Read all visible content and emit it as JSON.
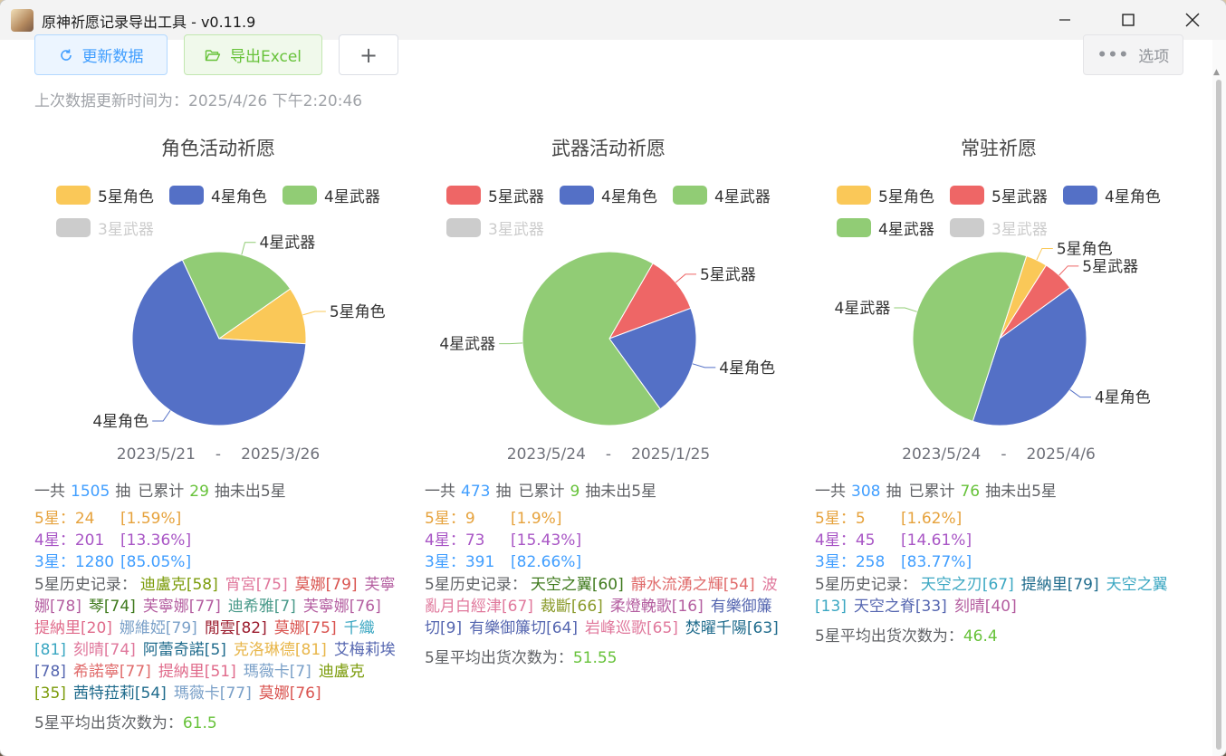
{
  "window": {
    "title": "原神祈愿记录导出工具 - v0.11.9"
  },
  "toolbar": {
    "refresh_label": "更新数据",
    "export_label": "导出Excel",
    "add_label": "+",
    "options_label": "选项"
  },
  "update_text": "上次数据更新时间为：2025/4/26 下午2:20:46",
  "colors": {
    "5star_char": "#fac858",
    "4star_char": "#5470c6",
    "4star_weapon": "#91cc75",
    "5star_weapon": "#ee6666",
    "3star_weapon": "#cccccc"
  },
  "panels": [
    {
      "title": "角色活动祈愿",
      "legend": [
        {
          "label": "5星角色",
          "color": "#fac858",
          "on": true
        },
        {
          "label": "4星角色",
          "color": "#5470c6",
          "on": true
        },
        {
          "label": "4星武器",
          "color": "#91cc75",
          "on": true
        },
        {
          "label": "3星武器",
          "color": "#cccccc",
          "on": false
        }
      ],
      "chart_data": {
        "type": "pie",
        "slices": [
          {
            "label": "5星角色",
            "value": 24,
            "color": "#fac858"
          },
          {
            "label": "4星角色",
            "value": 151,
            "color": "#5470c6"
          },
          {
            "label": "4星武器",
            "value": 50,
            "color": "#91cc75"
          }
        ]
      },
      "date_start": "2023/5/21",
      "date_sep": "-",
      "date_end": "2025/3/26",
      "total_prefix": "一共",
      "total": "1505",
      "total_unit": "抽",
      "acc_prefix": "已累计",
      "acc": "29",
      "acc_suffix": "抽未出5星",
      "stats": [
        {
          "label": "5星：24",
          "pct": "[1.59%]",
          "color": "#e6a23c"
        },
        {
          "label": "4星：201",
          "pct": "[13.36%]",
          "color": "#a855c5"
        },
        {
          "label": "3星：1280",
          "pct": "[85.05%]",
          "color": "#409eff"
        }
      ],
      "history_label": "5星历史记录：",
      "history": [
        {
          "text": "迪盧克[58]",
          "color": "#7b9b0a"
        },
        {
          "text": "宵宮[75]",
          "color": "#e0789c"
        },
        {
          "text": "莫娜[79]",
          "color": "#d9534f"
        },
        {
          "text": "芙寧娜[78]",
          "color": "#b45ea0"
        },
        {
          "text": "琴[74]",
          "color": "#3f7a1e"
        },
        {
          "text": "芙寧娜[77]",
          "color": "#b45ea0"
        },
        {
          "text": "迪希雅[7]",
          "color": "#4a9a8a"
        },
        {
          "text": "芙寧娜[76]",
          "color": "#b45ea0"
        },
        {
          "text": "提納里[20]",
          "color": "#e06b8b"
        },
        {
          "text": "娜維婭[79]",
          "color": "#7aa0c8"
        },
        {
          "text": "閒雲[82]",
          "color": "#9b1c2e"
        },
        {
          "text": "莫娜[75]",
          "color": "#d9534f"
        },
        {
          "text": "千織[81]",
          "color": "#3ba7c2"
        },
        {
          "text": "刻晴[74]",
          "color": "#e0789c"
        },
        {
          "text": "阿蕾奇諾[5]",
          "color": "#1f6b8c"
        },
        {
          "text": "克洛琳德[81]",
          "color": "#e8b64a"
        },
        {
          "text": "艾梅莉埃[78]",
          "color": "#5566b0"
        },
        {
          "text": "希諾寧[77]",
          "color": "#e06b6b"
        },
        {
          "text": "提納里[51]",
          "color": "#e06b8b"
        },
        {
          "text": "瑪薇卡[7]",
          "color": "#7aa0c8"
        },
        {
          "text": "迪盧克[35]",
          "color": "#7b9b0a"
        },
        {
          "text": "茜特菈莉[54]",
          "color": "#1f6b8c"
        },
        {
          "text": "瑪薇卡[77]",
          "color": "#7aa0c8"
        },
        {
          "text": "莫娜[76]",
          "color": "#d9534f"
        }
      ],
      "avg_label": "5星平均出货次数为：",
      "avg": "61.5"
    },
    {
      "title": "武器活动祈愿",
      "legend": [
        {
          "label": "5星武器",
          "color": "#ee6666",
          "on": true
        },
        {
          "label": "4星角色",
          "color": "#5470c6",
          "on": true
        },
        {
          "label": "4星武器",
          "color": "#91cc75",
          "on": true
        },
        {
          "label": "3星武器",
          "color": "#cccccc",
          "on": false
        }
      ],
      "chart_data": {
        "type": "pie",
        "slices": [
          {
            "label": "5星武器",
            "value": 9,
            "color": "#ee6666"
          },
          {
            "label": "4星角色",
            "value": 17,
            "color": "#5470c6"
          },
          {
            "label": "4星武器",
            "value": 56,
            "color": "#91cc75"
          }
        ]
      },
      "date_start": "2023/5/24",
      "date_sep": "-",
      "date_end": "2025/1/25",
      "total_prefix": "一共",
      "total": "473",
      "total_unit": "抽",
      "acc_prefix": "已累计",
      "acc": "9",
      "acc_suffix": "抽未出5星",
      "stats": [
        {
          "label": "5星：9",
          "pct": "[1.9%]",
          "color": "#e6a23c"
        },
        {
          "label": "4星：73",
          "pct": "[15.43%]",
          "color": "#a855c5"
        },
        {
          "label": "3星：391",
          "pct": "[82.66%]",
          "color": "#409eff"
        }
      ],
      "history_label": "5星历史记录：",
      "history": [
        {
          "text": "天空之翼[60]",
          "color": "#3f7a1e"
        },
        {
          "text": "靜水流湧之輝[54]",
          "color": "#e06b6b"
        },
        {
          "text": "波亂月白經津[67]",
          "color": "#e0789c"
        },
        {
          "text": "裁斷[66]",
          "color": "#8a9a2a"
        },
        {
          "text": "柔燈輓歌[16]",
          "color": "#b45ea0"
        },
        {
          "text": "有樂御簾切[9]",
          "color": "#5566b0"
        },
        {
          "text": "有樂御簾切[64]",
          "color": "#5566b0"
        },
        {
          "text": "岩峰巡歌[65]",
          "color": "#e0789c"
        },
        {
          "text": "焚曜千陽[63]",
          "color": "#1f6b8c"
        }
      ],
      "avg_label": "5星平均出货次数为：",
      "avg": "51.55"
    },
    {
      "title": "常驻祈愿",
      "legend": [
        {
          "label": "5星角色",
          "color": "#fac858",
          "on": true
        },
        {
          "label": "5星武器",
          "color": "#ee6666",
          "on": true
        },
        {
          "label": "4星角色",
          "color": "#5470c6",
          "on": true
        },
        {
          "label": "4星武器",
          "color": "#91cc75",
          "on": true
        },
        {
          "label": "3星武器",
          "color": "#cccccc",
          "on": false
        }
      ],
      "chart_data": {
        "type": "pie",
        "slices": [
          {
            "label": "5星角色",
            "value": 2,
            "color": "#fac858"
          },
          {
            "label": "5星武器",
            "value": 3,
            "color": "#ee6666"
          },
          {
            "label": "4星角色",
            "value": 20,
            "color": "#5470c6"
          },
          {
            "label": "4星武器",
            "value": 25,
            "color": "#91cc75"
          }
        ]
      },
      "date_start": "2023/5/24",
      "date_sep": "-",
      "date_end": "2025/4/6",
      "total_prefix": "一共",
      "total": "308",
      "total_unit": "抽",
      "acc_prefix": "已累计",
      "acc": "76",
      "acc_suffix": "抽未出5星",
      "stats": [
        {
          "label": "5星：5",
          "pct": "[1.62%]",
          "color": "#e6a23c"
        },
        {
          "label": "4星：45",
          "pct": "[14.61%]",
          "color": "#a855c5"
        },
        {
          "label": "3星：258",
          "pct": "[83.77%]",
          "color": "#409eff"
        }
      ],
      "history_label": "5星历史记录：",
      "history": [
        {
          "text": "天空之刃[67]",
          "color": "#3ba7c2"
        },
        {
          "text": "提納里[79]",
          "color": "#1f6b8c"
        },
        {
          "text": "天空之翼[13]",
          "color": "#3ba7c2"
        },
        {
          "text": "天空之脊[33]",
          "color": "#5566b0"
        },
        {
          "text": "刻晴[40]",
          "color": "#b45ea0"
        }
      ],
      "avg_label": "5星平均出货次数为：",
      "avg": "46.4"
    }
  ]
}
